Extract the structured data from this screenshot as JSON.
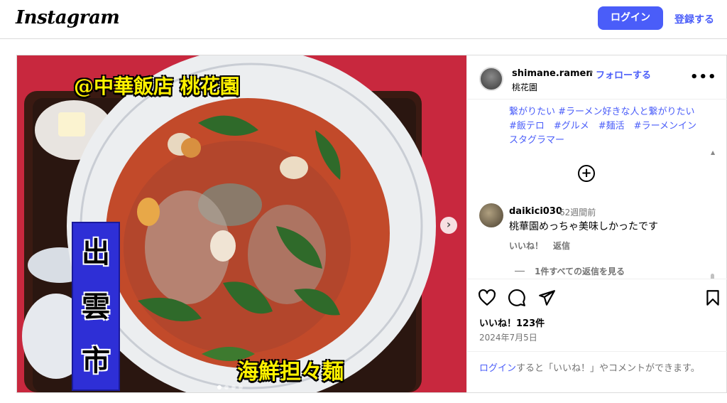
{
  "header": {
    "logo": "Instagram",
    "login_label": "ログイン",
    "signup_label": "登録する"
  },
  "media": {
    "caption_top": "@中華飯店 桃花園",
    "caption_city": [
      "出",
      "雲",
      "市"
    ],
    "caption_dish": "海鮮担々麺",
    "next_glyph": "›"
  },
  "post": {
    "username": "shimane.ramen",
    "separator": "•",
    "follow_label": "フォローする",
    "location": "桃花園",
    "more_glyph": "•••",
    "hashtags": "繋がりたい #ラーメン好きな人と繋がりたい #飯テロ　#グルメ　#麺活　#ラーメンインスタグラマー",
    "load_more_glyph": "+",
    "comment": {
      "username": "daikici030",
      "time": "62週間前",
      "text": "桃華園めっちゃ美味しかったです",
      "like_label": "いいね！",
      "reply_label": "返信",
      "view_replies": "1件すべての返信を見る"
    },
    "likes": "いいね！123件",
    "date": "2024年7月5日",
    "footer": {
      "link": "ログイン",
      "text": "すると「いいね！」やコメントができます。"
    }
  }
}
